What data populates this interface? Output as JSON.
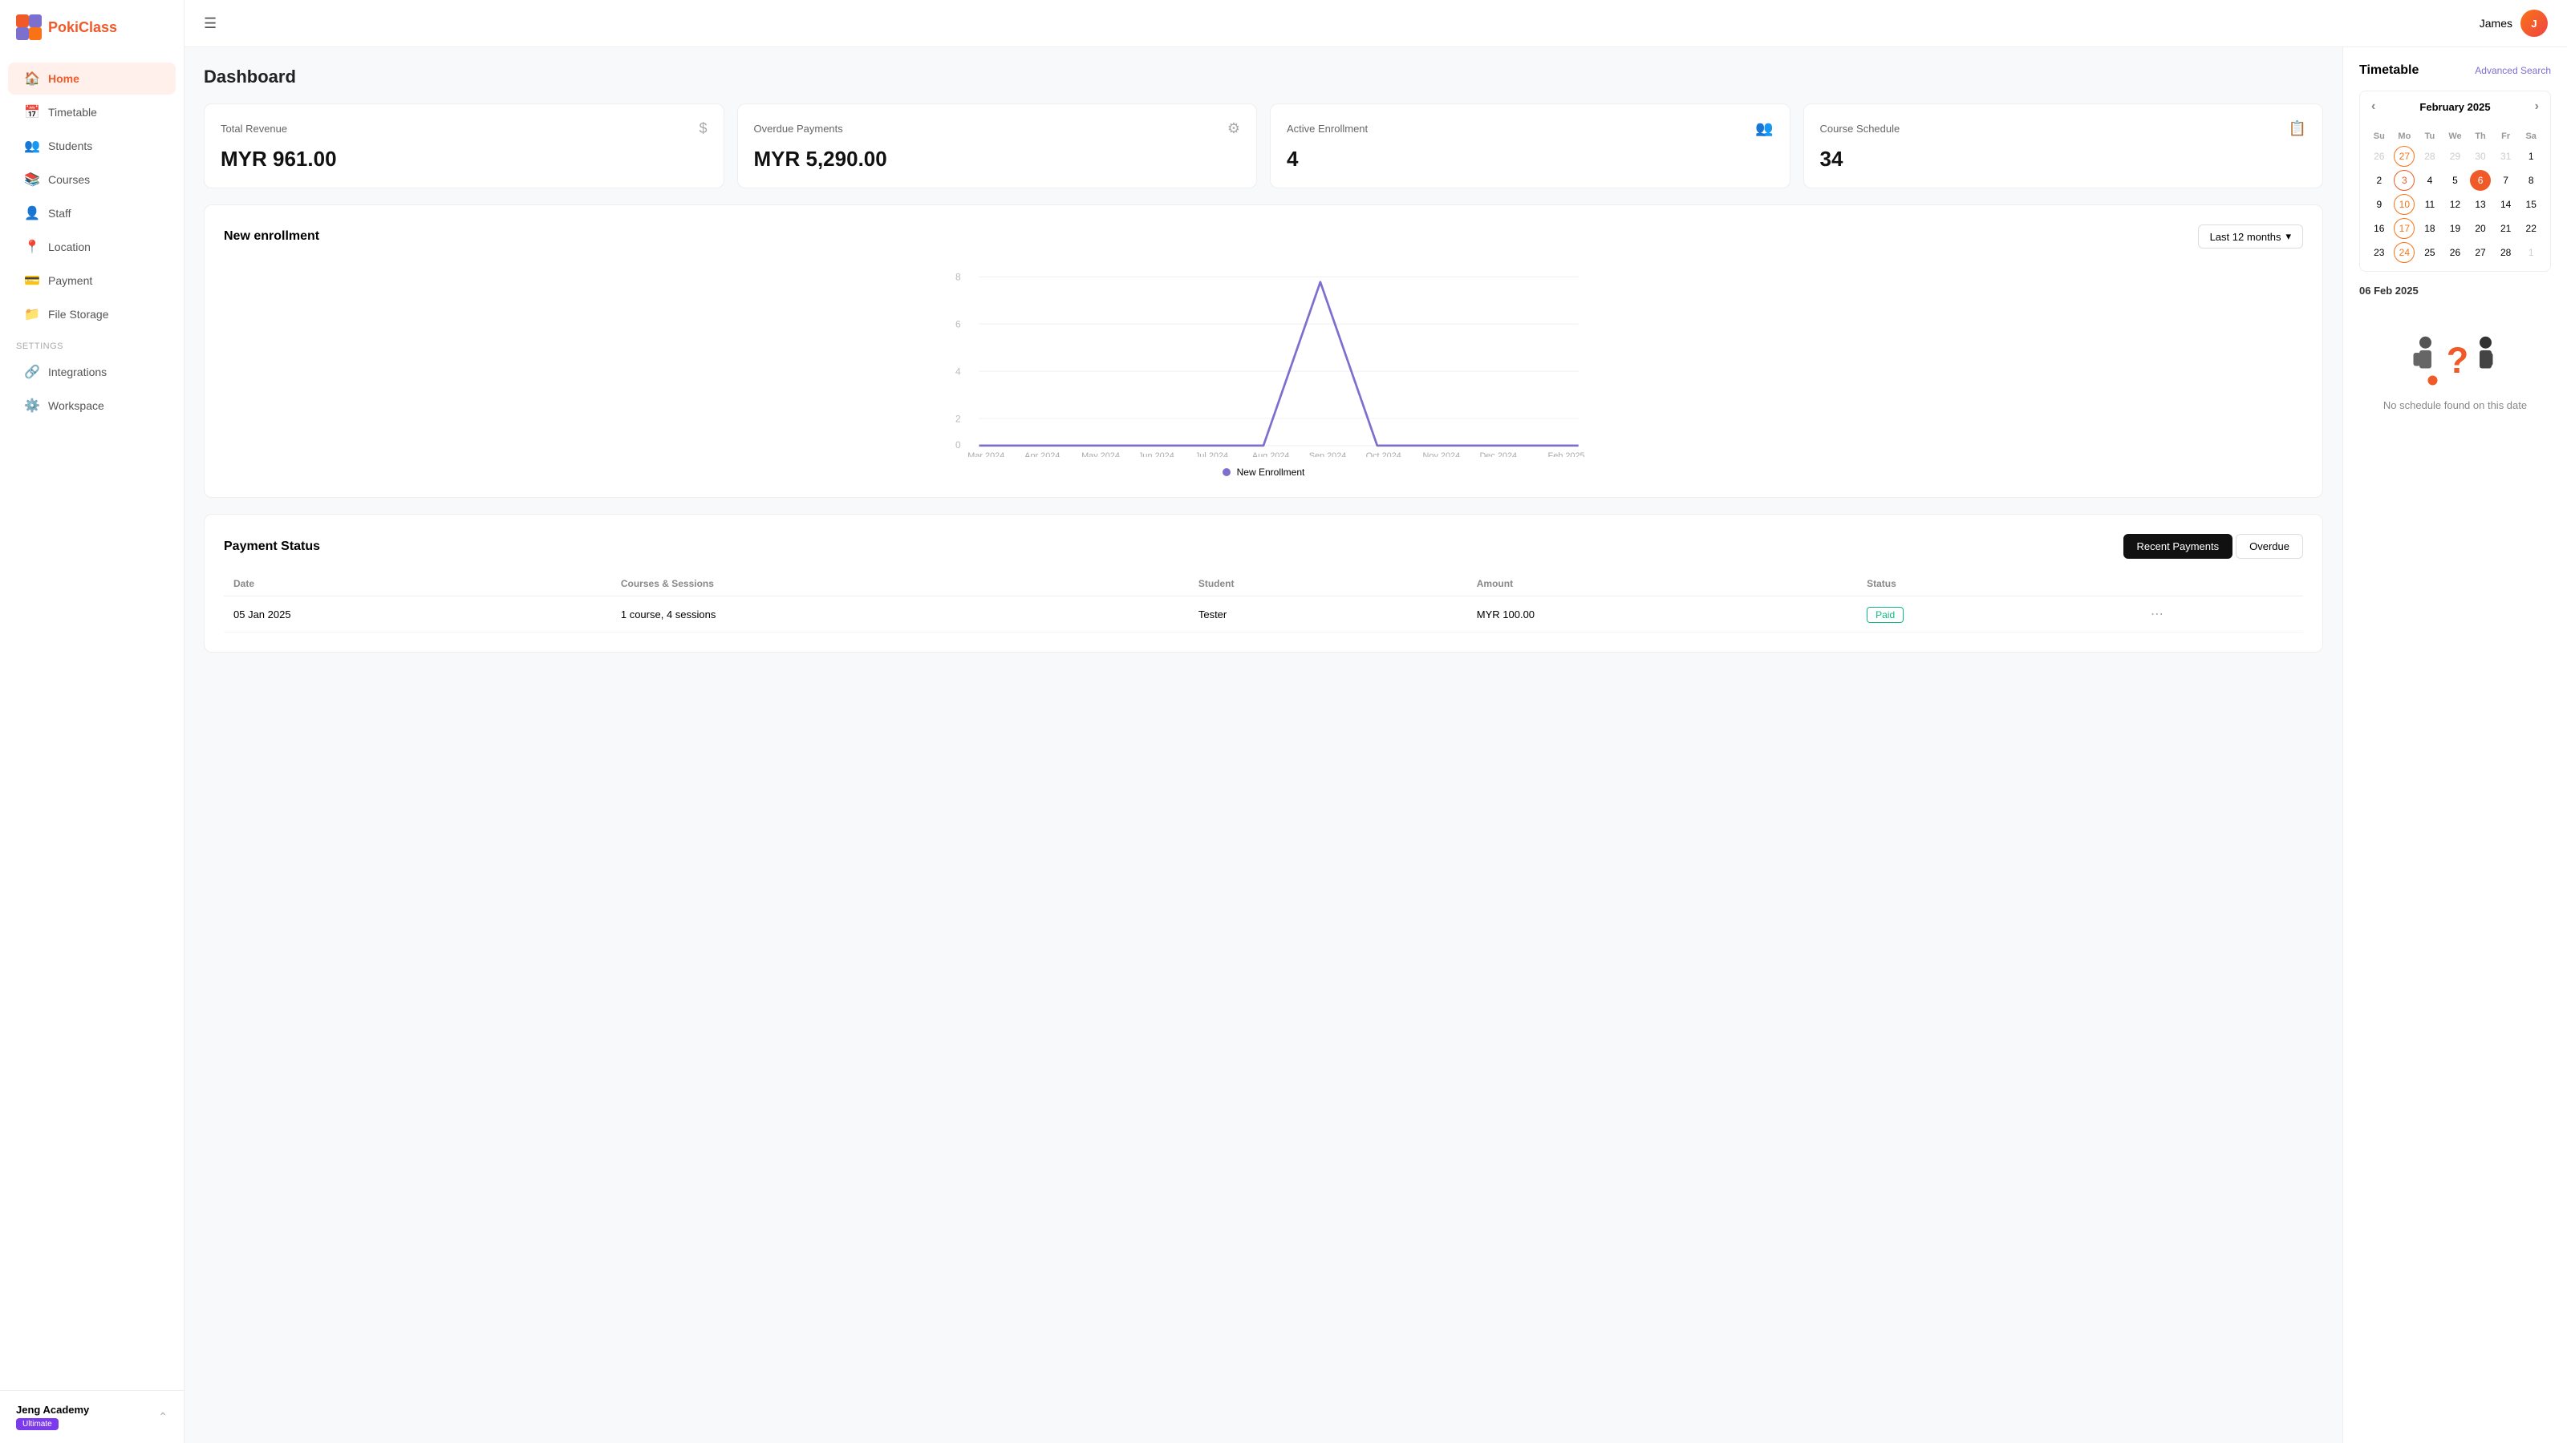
{
  "app": {
    "name": "PokiClass",
    "user": "James"
  },
  "sidebar": {
    "nav_items": [
      {
        "id": "home",
        "label": "Home",
        "icon": "🏠",
        "active": true
      },
      {
        "id": "timetable",
        "label": "Timetable",
        "icon": "📅",
        "active": false
      },
      {
        "id": "students",
        "label": "Students",
        "icon": "👥",
        "active": false
      },
      {
        "id": "courses",
        "label": "Courses",
        "icon": "📚",
        "active": false
      },
      {
        "id": "staff",
        "label": "Staff",
        "icon": "👤",
        "active": false
      },
      {
        "id": "location",
        "label": "Location",
        "icon": "📍",
        "active": false
      },
      {
        "id": "payment",
        "label": "Payment",
        "icon": "💳",
        "active": false
      },
      {
        "id": "file_storage",
        "label": "File Storage",
        "icon": "📁",
        "active": false
      }
    ],
    "settings_label": "Settings",
    "settings_items": [
      {
        "id": "integrations",
        "label": "Integrations",
        "icon": "🔗"
      },
      {
        "id": "workspace",
        "label": "Workspace",
        "icon": "⚙️"
      }
    ],
    "academy": {
      "name": "Jeng Academy",
      "plan": "Ultimate"
    }
  },
  "dashboard": {
    "title": "Dashboard",
    "stat_cards": [
      {
        "label": "Total Revenue",
        "value": "MYR 961.00",
        "icon": "$"
      },
      {
        "label": "Overdue Payments",
        "value": "MYR 5,290.00",
        "icon": "⚙"
      },
      {
        "label": "Active Enrollment",
        "value": "4",
        "icon": "👥"
      },
      {
        "label": "Course Schedule",
        "value": "34",
        "icon": "📋"
      }
    ],
    "chart": {
      "title": "New enrollment",
      "filter": "Last 12 months",
      "legend": "New Enrollment",
      "y_labels": [
        "8",
        "6",
        "4",
        "2",
        "0"
      ],
      "x_labels": [
        "Mar 2024",
        "Apr 2024",
        "May 2024",
        "Jun 2024",
        "Jul 2024",
        "Aug 2024",
        "Sep 2024",
        "Oct 2024",
        "Nov 2024",
        "Dec 2024",
        "Feb 2025"
      ]
    },
    "payment_status": {
      "title": "Payment Status",
      "tabs": [
        {
          "label": "Recent Payments",
          "active": true
        },
        {
          "label": "Overdue",
          "active": false
        }
      ],
      "columns": [
        "Date",
        "Courses & Sessions",
        "Student",
        "Amount",
        "Status"
      ],
      "rows": [
        {
          "date": "05 Jan 2025",
          "sessions": "1 course, 4 sessions",
          "student": "Tester",
          "amount": "MYR 100.00",
          "status": "Paid"
        }
      ]
    }
  },
  "timetable_panel": {
    "title": "Timetable",
    "advanced_search": "Advanced Search",
    "calendar": {
      "month": "February 2025",
      "days_of_week": [
        "Su",
        "Mo",
        "Tu",
        "We",
        "Th",
        "Fr",
        "Sa"
      ],
      "weeks": [
        [
          {
            "day": "26",
            "other": true
          },
          {
            "day": "27",
            "highlighted": true
          },
          {
            "day": "28",
            "other": true
          },
          {
            "day": "29",
            "other": true
          },
          {
            "day": "30",
            "other": true
          },
          {
            "day": "31",
            "other": true
          },
          {
            "day": "1"
          }
        ],
        [
          {
            "day": "2"
          },
          {
            "day": "3",
            "today": true
          },
          {
            "day": "4"
          },
          {
            "day": "5"
          },
          {
            "day": "6",
            "selected": true
          },
          {
            "day": "7"
          },
          {
            "day": "8"
          }
        ],
        [
          {
            "day": "9"
          },
          {
            "day": "10",
            "highlighted": true
          },
          {
            "day": "11"
          },
          {
            "day": "12"
          },
          {
            "day": "13"
          },
          {
            "day": "14"
          },
          {
            "day": "15"
          }
        ],
        [
          {
            "day": "16"
          },
          {
            "day": "17",
            "highlighted": true
          },
          {
            "day": "18"
          },
          {
            "day": "19"
          },
          {
            "day": "20"
          },
          {
            "day": "21"
          },
          {
            "day": "22"
          }
        ],
        [
          {
            "day": "23"
          },
          {
            "day": "24",
            "highlighted": true
          },
          {
            "day": "25"
          },
          {
            "day": "26"
          },
          {
            "day": "27"
          },
          {
            "day": "28"
          },
          {
            "day": "1",
            "other": true
          }
        ]
      ]
    },
    "selected_date": "06 Feb 2025",
    "no_schedule_text": "No schedule found on this date"
  }
}
